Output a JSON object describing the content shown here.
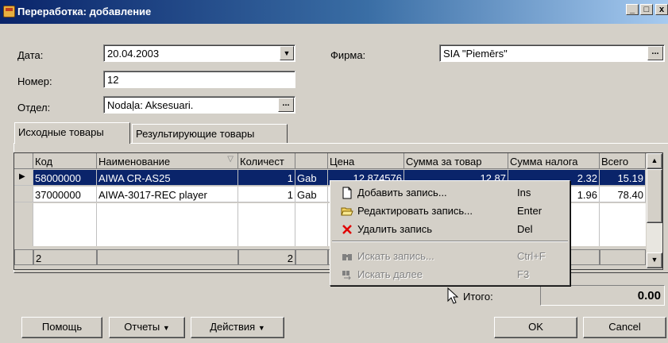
{
  "window": {
    "title": "Переработка: добавление",
    "minimize": "_",
    "maximize": "□",
    "close": "x"
  },
  "form": {
    "date_label": "Дата:",
    "date_value": "20.04.2003",
    "number_label": "Номер:",
    "number_value": "12",
    "department_label": "Отдел:",
    "department_value": "Nodaļa: Aksesuari.",
    "firm_label": "Фирма:",
    "firm_value": "SIA \"Piemērs\"",
    "ellipsis": "..."
  },
  "tabs": [
    {
      "label": "Исходные товары",
      "active": true
    },
    {
      "label": "Результирующие товары",
      "active": false
    }
  ],
  "grid": {
    "columns": [
      "Код",
      "Наименование",
      "Количест",
      "",
      "Цена",
      "Сумма за товар",
      "Сумма налога",
      "Всего"
    ],
    "rows": [
      {
        "code": "58000000",
        "name": "AIWA CR-AS25",
        "qty": "1",
        "unit": "Gab",
        "price": "12.874576",
        "sum": "12.87",
        "tax": "2.32",
        "total": "15.19",
        "selected": true
      },
      {
        "code": "37000000",
        "name": "AIWA-3017-REC player",
        "qty": "1",
        "unit": "Gab",
        "price": "",
        "sum": "",
        "tax": "1.96",
        "total": "78.40",
        "selected": false
      }
    ],
    "footer": {
      "count": "2",
      "qty_total": "2"
    }
  },
  "context_menu": {
    "items": [
      {
        "label": "Добавить запись...",
        "shortcut": "Ins",
        "icon": "new-page-icon",
        "enabled": true
      },
      {
        "label": "Редактировать запись...",
        "shortcut": "Enter",
        "icon": "open-folder-icon",
        "enabled": true
      },
      {
        "label": "Удалить запись",
        "shortcut": "Del",
        "icon": "red-x-icon",
        "enabled": true
      },
      {
        "label": "Искать запись...",
        "shortcut": "Ctrl+F",
        "icon": "binoculars-icon",
        "enabled": false
      },
      {
        "label": "Искать далее",
        "shortcut": "F3",
        "icon": "find-next-icon",
        "enabled": false
      }
    ]
  },
  "totals": {
    "label": "Итого:",
    "value": "0.00"
  },
  "buttons": {
    "help": "Помощь",
    "reports": "Отчеты",
    "actions": "Действия",
    "ok": "OK",
    "cancel": "Cancel"
  },
  "colors": {
    "selection": "#0a246a",
    "face": "#d4d0c8"
  }
}
